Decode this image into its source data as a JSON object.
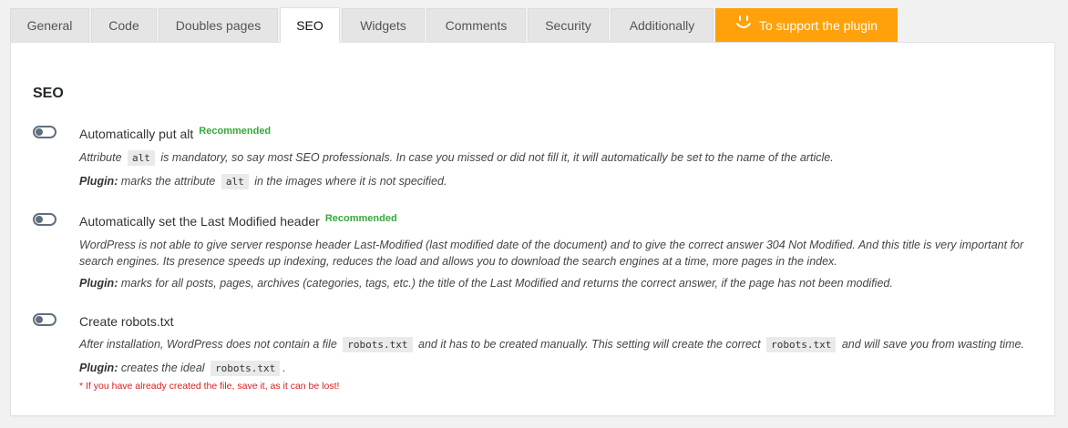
{
  "tabs": [
    {
      "label": "General",
      "active": false
    },
    {
      "label": "Code",
      "active": false
    },
    {
      "label": "Doubles pages",
      "active": false
    },
    {
      "label": "SEO",
      "active": true
    },
    {
      "label": "Widgets",
      "active": false
    },
    {
      "label": "Comments",
      "active": false
    },
    {
      "label": "Security",
      "active": false
    },
    {
      "label": "Additionally",
      "active": false
    }
  ],
  "support_tab": {
    "label": "To support the plugin",
    "icon": "smile-icon",
    "color": "#ffa10a"
  },
  "section_title": "SEO",
  "recommended_color": "#35a83b",
  "options": [
    {
      "title": "Automatically put alt",
      "badge": "Recommended",
      "enabled": false,
      "desc_pre": "Attribute",
      "desc_code": "alt",
      "desc_post": "is mandatory, so say most SEO professionals. In case you missed or did not fill it, it will automatically be set to the name of the article.",
      "plugin_label": "Plugin:",
      "plugin_pre": "marks the attribute",
      "plugin_code": "alt",
      "plugin_post": "in the images where it is not specified."
    },
    {
      "title": "Automatically set the Last Modified header",
      "badge": "Recommended",
      "enabled": false,
      "desc": "WordPress is not able to give server response header Last-Modified (last modified date of the document) and to give the correct answer 304 Not Modified. And this title is very important for search engines. Its presence speeds up indexing, reduces the load and allows you to download the search engines at a time, more pages in the index.",
      "plugin_label": "Plugin:",
      "plugin_text": "marks for all posts, pages, archives (categories, tags, etc.) the title of the Last Modified and returns the correct answer, if the page has not been modified."
    },
    {
      "title": "Create robots.txt",
      "enabled": false,
      "desc_pre": "After installation, WordPress does not contain a file",
      "desc_code": "robots.txt",
      "desc_mid": "and it has to be created manually. This setting will create the correct",
      "desc_code2": "robots.txt",
      "desc_post": "and will save you from wasting time.",
      "plugin_label": "Plugin:",
      "plugin_pre": "creates the ideal",
      "plugin_code": "robots.txt",
      "plugin_post": ".",
      "warning": "* If you have already created the file, save it, as it can be lost!",
      "warning_color": "#d71e1e"
    }
  ]
}
